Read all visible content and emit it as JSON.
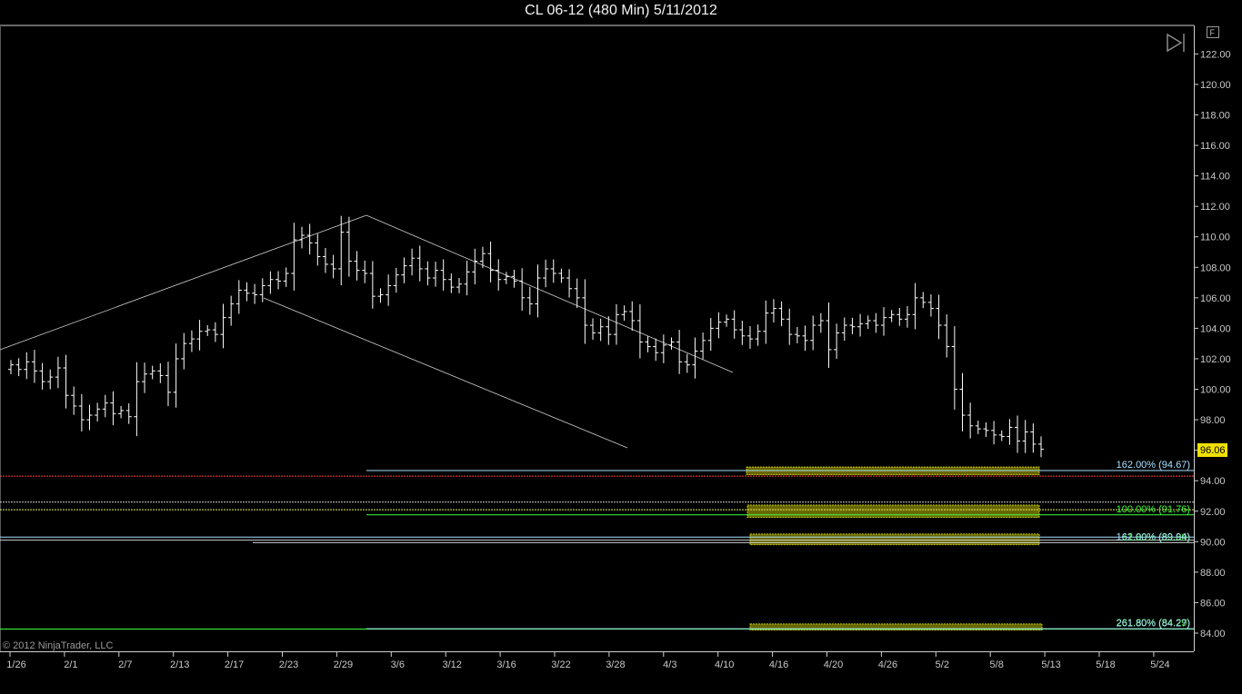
{
  "title": "CL 06-12 (480 Min)  5/11/2012",
  "copyright": "© 2012 NinjaTrader, LLC",
  "f_button_label": "F",
  "last_price_label": "96.06",
  "colors": {
    "background": "#000000",
    "bars": "#ffffff",
    "axis": "#d0d0d0",
    "last_price_badge": "#f0e000",
    "fib_box": "#9a9a00",
    "fib_line_cyan": "#a8e0ff",
    "fib_line_green": "#40ff40",
    "fib_line_red": "#ff4040"
  },
  "chart_data": {
    "type": "ohlc",
    "x_labels": [
      "1/26",
      "2/1",
      "2/7",
      "2/13",
      "2/17",
      "2/23",
      "2/29",
      "3/6",
      "3/12",
      "3/16",
      "3/22",
      "3/28",
      "4/3",
      "4/10",
      "4/16",
      "4/20",
      "4/26",
      "5/2",
      "5/8",
      "5/13",
      "5/18",
      "5/24"
    ],
    "y_ticks": [
      "84.00",
      "86.00",
      "88.00",
      "90.00",
      "92.00",
      "94.00",
      "96.00",
      "98.00",
      "100.00",
      "102.00",
      "104.00",
      "106.00",
      "108.00",
      "110.00",
      "112.00",
      "114.00",
      "116.00",
      "118.00",
      "120.00",
      "122.00"
    ],
    "ylim": [
      83.0,
      123.0
    ],
    "last_price": 96.06,
    "closes": [
      101.6,
      101.3,
      101.8,
      101.2,
      100.5,
      100.8,
      101.4,
      99.6,
      98.9,
      98.0,
      98.3,
      98.7,
      99.1,
      98.4,
      98.6,
      98.2,
      100.5,
      101.0,
      101.2,
      100.9,
      99.8,
      102.0,
      103.0,
      103.3,
      103.8,
      103.9,
      103.6,
      104.7,
      105.6,
      106.5,
      106.3,
      106.2,
      106.8,
      107.2,
      107.1,
      107.6,
      109.8,
      110.1,
      109.6,
      108.7,
      108.2,
      107.9,
      110.3,
      108.4,
      107.8,
      107.6,
      106.1,
      106.2,
      106.8,
      107.5,
      108.1,
      108.6,
      107.9,
      107.3,
      107.8,
      107.2,
      106.7,
      106.9,
      107.7,
      108.4,
      108.9,
      107.8,
      107.2,
      107.4,
      107.1,
      106.0,
      105.6,
      107.3,
      107.9,
      107.6,
      107.3,
      106.6,
      106.0,
      104.2,
      103.7,
      104.1,
      103.6,
      104.9,
      105.1,
      104.5,
      103.1,
      102.8,
      102.4,
      102.9,
      103.1,
      101.8,
      101.6,
      102.5,
      103.2,
      104.0,
      104.4,
      104.6,
      103.9,
      103.5,
      103.3,
      103.8,
      105.0,
      105.3,
      104.6,
      103.6,
      103.5,
      103.2,
      104.2,
      104.5,
      102.6,
      103.7,
      104.2,
      104.1,
      104.3,
      104.5,
      104.2,
      104.7,
      104.9,
      104.6,
      104.9,
      106.0,
      105.7,
      105.3,
      104.2,
      102.8,
      100.0,
      98.3,
      97.6,
      97.4,
      97.3,
      97.0,
      96.9,
      97.5,
      96.6,
      97.2,
      96.4,
      96.06
    ],
    "fib_labels": [
      {
        "text": "162.00% (94.67)",
        "price": 94.67
      },
      {
        "text": "100.00% (91.76)",
        "price": 91.76
      },
      {
        "text": "61.80% (89.89)",
        "price": 89.89
      },
      {
        "text": "162.00% (89.94)",
        "price": 89.94
      },
      {
        "text": "261.80% (84.29)",
        "price": 84.29
      },
      {
        "text": "261.80% (84.27)",
        "price": 84.27
      }
    ]
  }
}
